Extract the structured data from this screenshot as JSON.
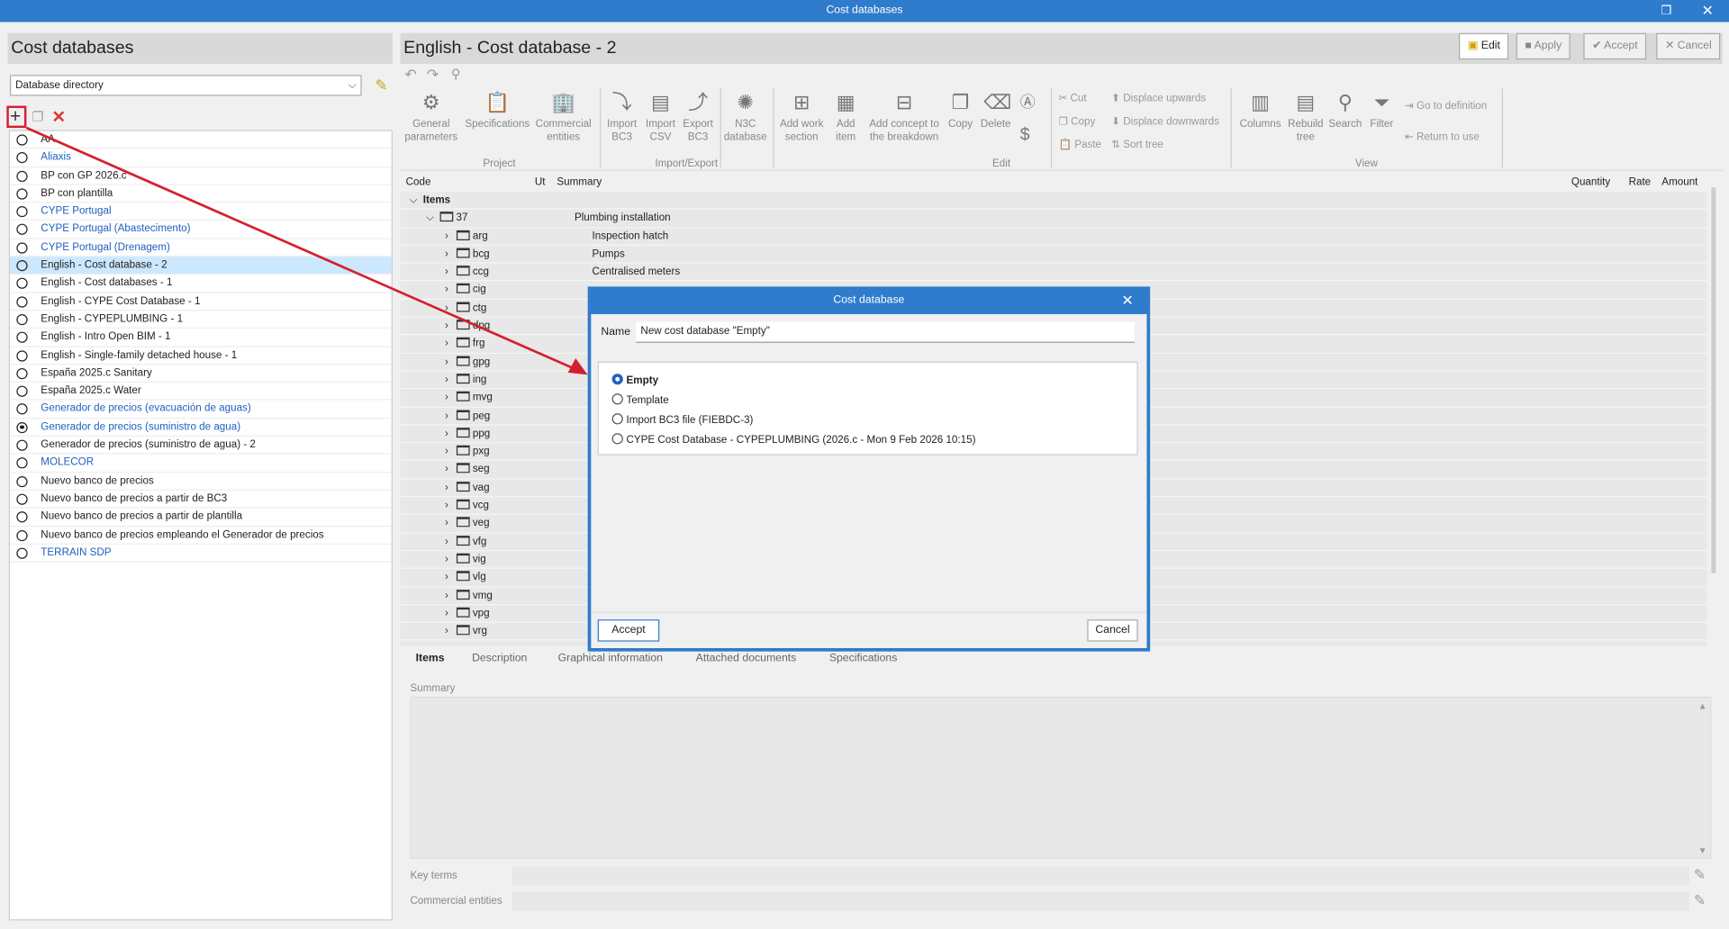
{
  "window": {
    "title": "Cost databases"
  },
  "left": {
    "title": "Cost databases",
    "directory": "Database directory",
    "items": [
      {
        "label": "AA",
        "link": false,
        "selected": false,
        "checked": false
      },
      {
        "label": "Aliaxis",
        "link": true
      },
      {
        "label": "BP con GP 2026.c",
        "link": false
      },
      {
        "label": "BP con plantilla",
        "link": false
      },
      {
        "label": "CYPE Portugal",
        "link": true
      },
      {
        "label": "CYPE Portugal (Abastecimento)",
        "link": true
      },
      {
        "label": "CYPE Portugal (Drenagem)",
        "link": true
      },
      {
        "label": "English - Cost database - 2",
        "link": false,
        "selected": true
      },
      {
        "label": "English - Cost databases - 1",
        "link": false
      },
      {
        "label": "English - CYPE Cost Database - 1",
        "link": false
      },
      {
        "label": "English - CYPEPLUMBING - 1",
        "link": false
      },
      {
        "label": "English - Intro Open BIM - 1",
        "link": false
      },
      {
        "label": "English - Single-family detached house - 1",
        "link": false
      },
      {
        "label": "España 2025.c Sanitary",
        "link": false
      },
      {
        "label": "España 2025.c Water",
        "link": false
      },
      {
        "label": "Generador de precios (evacuación de aguas)",
        "link": true
      },
      {
        "label": "Generador de precios (suministro de agua)",
        "link": true,
        "checked": true
      },
      {
        "label": "Generador de precios (suministro de agua) - 2",
        "link": false
      },
      {
        "label": "MOLECOR",
        "link": true
      },
      {
        "label": "Nuevo banco de precios",
        "link": false
      },
      {
        "label": "Nuevo banco de precios a partir de BC3",
        "link": false
      },
      {
        "label": "Nuevo banco de precios a partir de plantilla",
        "link": false
      },
      {
        "label": "Nuevo banco de precios empleando el Generador de precios",
        "link": false
      },
      {
        "label": "TERRAIN SDP",
        "link": true
      }
    ]
  },
  "main": {
    "title": "English - Cost database - 2",
    "buttons": {
      "edit": "Edit",
      "apply": "Apply",
      "accept": "Accept",
      "cancel": "Cancel"
    },
    "ribbon": {
      "general": "General parameters",
      "specifications": "Specifications",
      "commercial": "Commercial entities",
      "project": "Project",
      "import_bc3": "Import BC3",
      "import_csv": "Import CSV",
      "export_bc3": "Export BC3",
      "n3c": "N3C database",
      "import_export": "Import/Export",
      "add_work_section": "Add work section",
      "add_item": "Add item",
      "add_concept": "Add concept to the breakdown",
      "copy": "Copy",
      "delete": "Delete",
      "edit": "Edit",
      "cut": "Cut",
      "copy_small": "Copy",
      "paste": "Paste",
      "displace_up": "Displace upwards",
      "displace_down": "Displace downwards",
      "sort_tree": "Sort tree",
      "columns": "Columns",
      "rebuild_tree": "Rebuild tree",
      "search": "Search",
      "filter": "Filter",
      "go_to_definition": "Go to definition",
      "return_to_use": "Return to use",
      "view": "View"
    },
    "columns": {
      "code": "Code",
      "ut": "Ut",
      "summary": "Summary",
      "quantity": "Quantity",
      "rate": "Rate",
      "amount": "Amount"
    },
    "tree": {
      "root": "Items",
      "chapter": {
        "code": "37",
        "summary": "Plumbing installation"
      },
      "children": [
        {
          "code": "arg",
          "summary": "Inspection hatch"
        },
        {
          "code": "bcg",
          "summary": "Pumps"
        },
        {
          "code": "ccg",
          "summary": "Centralised meters"
        },
        {
          "code": "cig"
        },
        {
          "code": "ctg"
        },
        {
          "code": "dpg"
        },
        {
          "code": "frg"
        },
        {
          "code": "gpg"
        },
        {
          "code": "ing"
        },
        {
          "code": "mvg"
        },
        {
          "code": "peg"
        },
        {
          "code": "ppg"
        },
        {
          "code": "pxg"
        },
        {
          "code": "seg"
        },
        {
          "code": "vag"
        },
        {
          "code": "vcg"
        },
        {
          "code": "veg"
        },
        {
          "code": "vfg"
        },
        {
          "code": "vig"
        },
        {
          "code": "vlg"
        },
        {
          "code": "vmg"
        },
        {
          "code": "vpg"
        },
        {
          "code": "vrg"
        }
      ]
    },
    "tabs": [
      "Items",
      "Description",
      "Graphical information",
      "Attached documents",
      "Specifications"
    ],
    "summary_label": "Summary",
    "key_terms_label": "Key terms",
    "commercial_entities_label": "Commercial entities"
  },
  "dialog": {
    "title": "Cost database",
    "name_label": "Name",
    "name_value": "New cost database \"Empty\"",
    "options": [
      {
        "label": "Empty",
        "selected": true
      },
      {
        "label": "Template"
      },
      {
        "label": "Import BC3 file (FIEBDC-3)"
      },
      {
        "label": "CYPE Cost Database - CYPEPLUMBING (2026.c - Mon  9 Feb 2026  10:15)"
      }
    ],
    "accept": "Accept",
    "cancel": "Cancel"
  },
  "colors": {
    "accent": "#2f7bcc",
    "annotation": "#d32030",
    "link": "#1f5fbf",
    "selection": "#cce8ff"
  }
}
